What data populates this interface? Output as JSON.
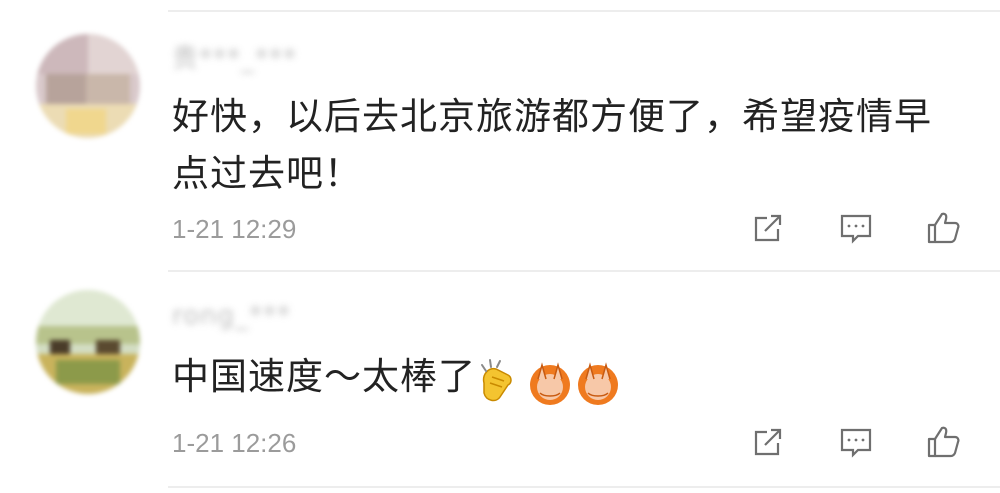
{
  "comments": [
    {
      "username": "贵***_***",
      "text": "好快，以后去北京旅游都方便了，希望疫情早点过去吧！",
      "time": "1-21 12:29",
      "icons": [
        "share-icon",
        "reply-icon",
        "like-icon"
      ],
      "avatar_colors": [
        "#d8c6c9",
        "#c5b3a8",
        "#e6d8a3",
        "#b8a59a",
        "#efe0b9"
      ]
    },
    {
      "username": "rong_***",
      "text": "中国速度～太棒了",
      "emojis": [
        "clapping-hands-emoji",
        "thumbs-up-monkey-emoji",
        "thumbs-up-monkey-emoji"
      ],
      "time": "1-21 12:26",
      "icons": [
        "share-icon",
        "reply-icon",
        "like-icon"
      ],
      "avatar_colors": [
        "#d6e2c9",
        "#8e9a5a",
        "#c6d6a0",
        "#4b3f2a",
        "#e0c06a"
      ]
    }
  ],
  "colors": {
    "text": "#222222",
    "meta": "#9b9b9b",
    "divider": "#ededed",
    "icon": "#6f6f6f"
  }
}
